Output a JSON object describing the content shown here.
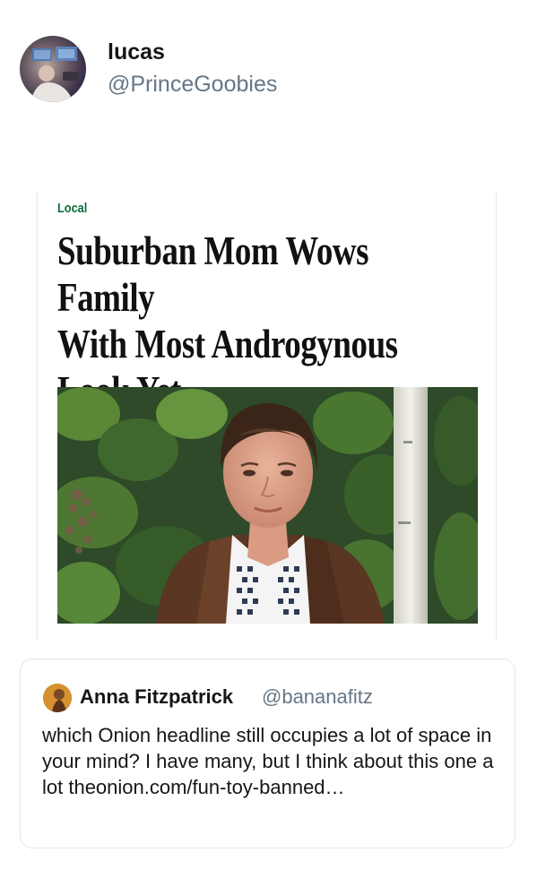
{
  "tweet": {
    "display_name": "lucas",
    "handle": "@PrinceGoobies"
  },
  "article": {
    "section": "Local",
    "headline_lines": [
      "Suburban Mom Wows Family",
      "With Most Androgynous",
      "Look Yet"
    ]
  },
  "quoted_tweet": {
    "display_name": "Anna Fitzpatrick",
    "handle": "@bananafitz",
    "text": "which Onion headline still occupies a lot of space in your mind? I have many, but I think about this one a lot theonion.com/fun-toy-banned…"
  },
  "colors": {
    "section_green": "#0b6e3c",
    "handle_gray": "#657786",
    "border": "#e1e8ed"
  }
}
